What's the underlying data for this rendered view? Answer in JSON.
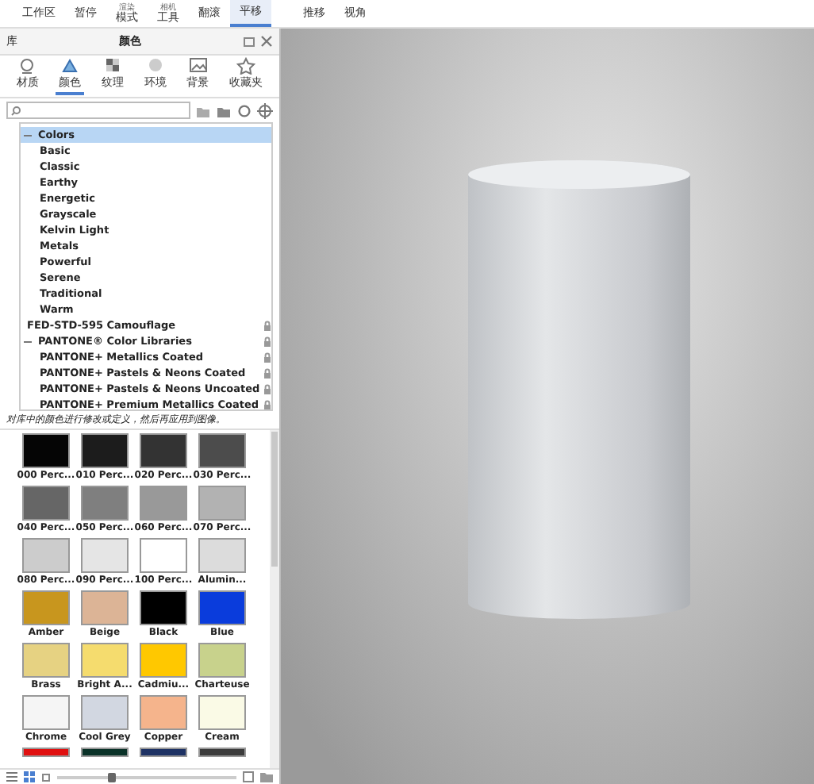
{
  "menu": [
    {
      "label": "工作区",
      "selected": false
    },
    {
      "label": "暂停",
      "selected": false
    },
    {
      "sublabel": "渲染",
      "label": "模式",
      "selected": false
    },
    {
      "sublabel": "相机",
      "label": "工具",
      "selected": false
    },
    {
      "label": "翻滚",
      "selected": false
    },
    {
      "label": "平移",
      "selected": true
    },
    {
      "label": "推移",
      "selected": false
    },
    {
      "label": "视角",
      "selected": false
    }
  ],
  "panel": {
    "title": "库",
    "subtitle": "颜色",
    "tabs": [
      {
        "label": "材质",
        "selected": false
      },
      {
        "label": "颜色",
        "selected": true
      },
      {
        "label": "纹理",
        "selected": false
      },
      {
        "label": "环境",
        "selected": false
      },
      {
        "label": "背景",
        "selected": false
      },
      {
        "label": "收藏夹",
        "selected": false
      }
    ],
    "tree": [
      {
        "label": "Colors",
        "selected": true,
        "expanded": true,
        "locked": false,
        "children": [
          {
            "label": "Basic",
            "selected": false,
            "locked": false
          },
          {
            "label": "Classic",
            "selected": false,
            "locked": false
          },
          {
            "label": "Earthy",
            "selected": false,
            "locked": false
          },
          {
            "label": "Energetic",
            "selected": false,
            "locked": false
          },
          {
            "label": "Grayscale",
            "selected": false,
            "locked": false
          },
          {
            "label": "Kelvin Light",
            "selected": false,
            "locked": false
          },
          {
            "label": "Metals",
            "selected": false,
            "locked": false
          },
          {
            "label": "Powerful",
            "selected": false,
            "locked": false
          },
          {
            "label": "Serene",
            "selected": false,
            "locked": false
          },
          {
            "label": "Traditional",
            "selected": false,
            "locked": false
          },
          {
            "label": "Warm",
            "selected": false,
            "locked": false
          }
        ]
      },
      {
        "label": "FED-STD-595 Camouflage",
        "selected": false,
        "locked": true
      },
      {
        "label": "PANTONE® Color Libraries",
        "selected": false,
        "expanded": true,
        "locked": true,
        "children": [
          {
            "label": "PANTONE+ Metallics Coated",
            "selected": false,
            "locked": true
          },
          {
            "label": "PANTONE+ Pastels & Neons Coated",
            "selected": false,
            "locked": true
          },
          {
            "label": "PANTONE+ Pastels & Neons Uncoated",
            "selected": false,
            "locked": true
          },
          {
            "label": "PANTONE+ Premium Metallics Coated",
            "selected": false,
            "locked": true
          }
        ]
      }
    ],
    "hint": "对库中的颜色进行修改或定义，然后再应用到图像。",
    "swatches": [
      {
        "name": "000 Perc...",
        "color": "#050505"
      },
      {
        "name": "010 Perc...",
        "color": "#1c1c1c"
      },
      {
        "name": "020 Perc...",
        "color": "#333333"
      },
      {
        "name": "030 Perc...",
        "color": "#4c4c4c"
      },
      {
        "name": "040 Perc...",
        "color": "#666666"
      },
      {
        "name": "050 Perc...",
        "color": "#7f7f7f"
      },
      {
        "name": "060 Perc...",
        "color": "#999999"
      },
      {
        "name": "070 Perc...",
        "color": "#b2b2b2"
      },
      {
        "name": "080 Perc...",
        "color": "#cccccc"
      },
      {
        "name": "090 Perc...",
        "color": "#e5e5e5"
      },
      {
        "name": "100 Perc...",
        "color": "#ffffff"
      },
      {
        "name": "Alumin...",
        "color": "#dcdcdc"
      },
      {
        "name": "Amber",
        "color": "#c8961e"
      },
      {
        "name": "Beige",
        "color": "#dcb496"
      },
      {
        "name": "Black",
        "color": "#000000"
      },
      {
        "name": "Blue",
        "color": "#0a3cdc"
      },
      {
        "name": "Brass",
        "color": "#e6d282"
      },
      {
        "name": "Bright A...",
        "color": "#f5dc6e"
      },
      {
        "name": "Cadmiu...",
        "color": "#ffc800"
      },
      {
        "name": "Charteuse",
        "color": "#c8d28c"
      },
      {
        "name": "Chrome",
        "color": "#f5f5f5"
      },
      {
        "name": "Cool Grey",
        "color": "#d2d7e1"
      },
      {
        "name": "Copper",
        "color": "#f5b48c"
      },
      {
        "name": "Cream",
        "color": "#fafae6"
      },
      {
        "color": "#e01010"
      },
      {
        "color": "#0a3228"
      },
      {
        "color": "#1e3264"
      },
      {
        "color": "#3c3c3c"
      }
    ],
    "size_slider": {
      "level": 0.3
    }
  }
}
